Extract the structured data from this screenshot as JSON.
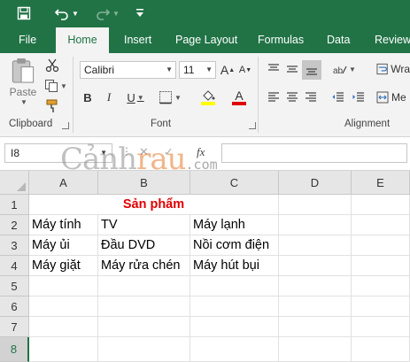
{
  "colors": {
    "accent": "#217346",
    "title_red": "#e00000",
    "font_highlight": "#ffff00",
    "font_color": "#e00000"
  },
  "quick_access": {
    "icons": [
      "save-icon",
      "undo-icon",
      "redo-icon",
      "customize-icon"
    ]
  },
  "tabs": [
    {
      "label": "File",
      "active": false
    },
    {
      "label": "Home",
      "active": true
    },
    {
      "label": "Insert",
      "active": false
    },
    {
      "label": "Page Layout",
      "active": false
    },
    {
      "label": "Formulas",
      "active": false
    },
    {
      "label": "Data",
      "active": false
    },
    {
      "label": "Review",
      "active": false
    }
  ],
  "ribbon": {
    "clipboard": {
      "label": "Clipboard",
      "paste_label": "Paste"
    },
    "font": {
      "label": "Font",
      "font_name": "Calibri",
      "font_size": "11",
      "bold": "B",
      "italic": "I",
      "underline": "U"
    },
    "alignment": {
      "label": "Alignment",
      "wrap_label": "Wra",
      "merge_label": "Me"
    }
  },
  "formula_bar": {
    "name_box": "I8",
    "fx_label": "fx",
    "value": ""
  },
  "watermark": {
    "part1": "Cảnh",
    "part2": "rau",
    "part3": ".com"
  },
  "sheet": {
    "columns": [
      "A",
      "B",
      "C",
      "D",
      "E"
    ],
    "rows": [
      "1",
      "2",
      "3",
      "4",
      "5",
      "6",
      "7",
      "8"
    ],
    "selected_row": "8",
    "title": "Sản phẩm",
    "cells": [
      [
        "Máy tính",
        "TV",
        "Máy lạnh"
      ],
      [
        "Máy ủi",
        "Đầu DVD",
        "Nồi cơm điện"
      ],
      [
        "Máy giặt",
        "Máy rửa chén",
        "Máy hút bụi"
      ]
    ]
  }
}
